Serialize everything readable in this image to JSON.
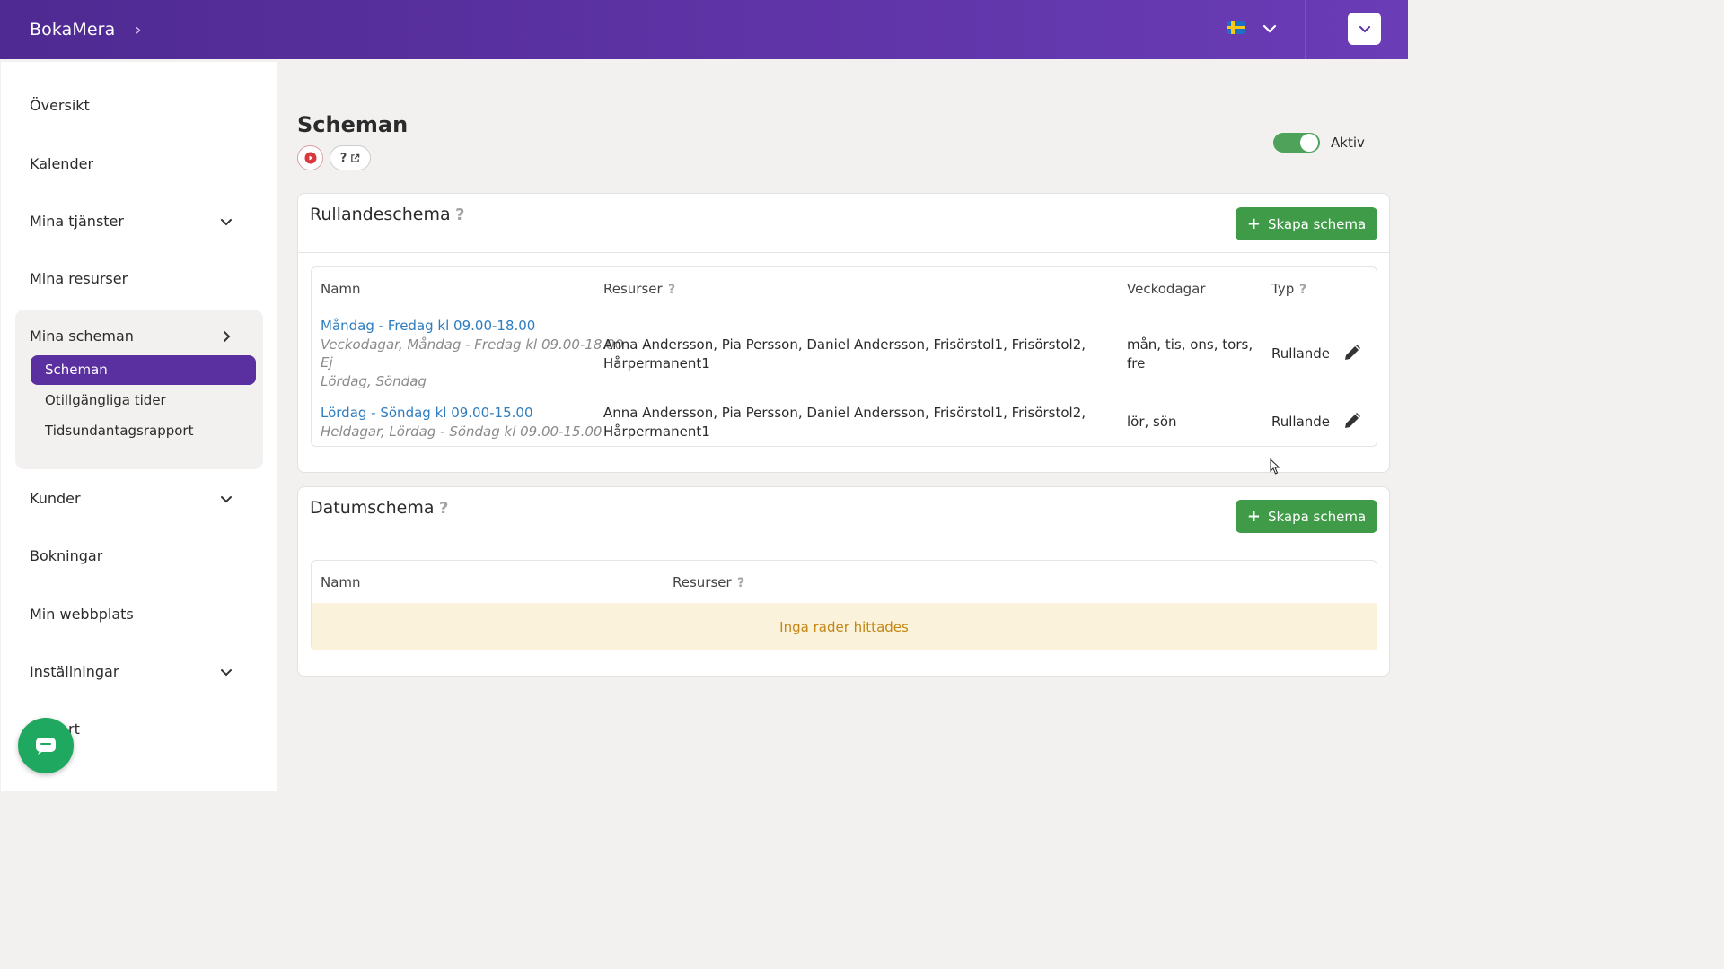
{
  "topbar": {
    "brand": "BokaMera",
    "brand_chevron": "›"
  },
  "sidebar": {
    "items": [
      {
        "label": "Översikt"
      },
      {
        "label": "Kalender"
      },
      {
        "label": "Mina tjänster"
      },
      {
        "label": "Mina resurser"
      },
      {
        "label": "Mina scheman"
      },
      {
        "label": "Kunder"
      },
      {
        "label": "Bokningar"
      },
      {
        "label": "Min webbplats"
      },
      {
        "label": "Inställningar"
      },
      {
        "label": "rt"
      }
    ],
    "sub_items": [
      {
        "label": "Scheman"
      },
      {
        "label": "Otillgängliga tider"
      },
      {
        "label": "Tidsundantagsrapport"
      }
    ]
  },
  "page": {
    "title": "Scheman",
    "help_label": "?",
    "toggle_label": "Aktiv",
    "toggle_on": true
  },
  "rolling": {
    "title": "Rullandeschema",
    "add_label": "Skapa schema",
    "headers": {
      "name": "Namn",
      "resources": "Resurser",
      "weekdays": "Veckodagar",
      "type": "Typ"
    },
    "rows": [
      {
        "name": "Måndag - Fredag kl 09.00-18.00",
        "sub1": "Veckodagar, Måndag - Fredag kl 09.00-18.00",
        "sub2": "Ej",
        "sub3": "Lördag, Söndag",
        "resources_1": "Anna Andersson, Pia Persson, Daniel Andersson, Frisörstol1, Frisörstol2,",
        "resources_2": "Hårpermanent1",
        "weekdays_1": "mån, tis, ons, tors,",
        "weekdays_2": "fre",
        "type": "Rullande"
      },
      {
        "name": "Lördag - Söndag kl 09.00-15.00",
        "sub1": "Heldagar, Lördag - Söndag kl 09.00-15.00",
        "resources_1": "Anna Andersson, Pia Persson, Daniel Andersson, Frisörstol1, Frisörstol2,",
        "resources_2": "Hårpermanent1",
        "weekdays_1": "lör, sön",
        "type": "Rullande"
      }
    ]
  },
  "dated": {
    "title": "Datumschema",
    "add_label": "Skapa schema",
    "headers": {
      "name": "Namn",
      "resources": "Resurser"
    },
    "empty_text": "Inga rader hittades"
  },
  "colors": {
    "brand_purple": "#5a2f9f",
    "add_green": "#3f9b47",
    "link_blue": "#2e7dbf",
    "empty_bg": "#fbf2dc"
  }
}
